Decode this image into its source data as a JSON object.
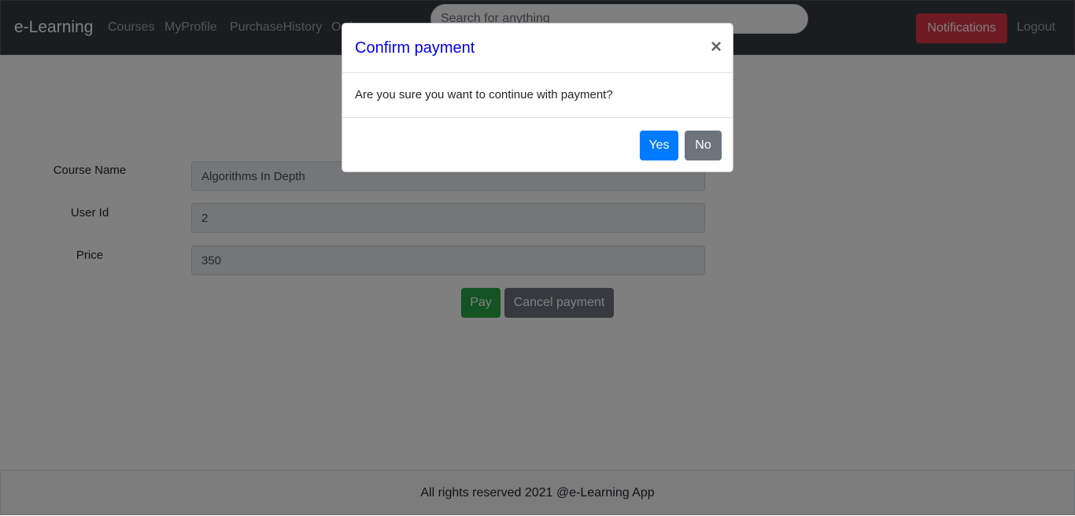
{
  "navbar": {
    "brand": "e-Learning",
    "links": [
      "Courses",
      "MyProfile",
      "PurchaseHistory",
      "Orders"
    ],
    "search_placeholder": "Search for anything",
    "notifications_label": "Notifications",
    "logout_label": "Logout"
  },
  "form": {
    "fields": [
      {
        "label": "Course Name",
        "value": "Algorithms In Depth"
      },
      {
        "label": "User Id",
        "value": "2"
      },
      {
        "label": "Price",
        "value": "350"
      }
    ],
    "pay_label": "Pay",
    "cancel_label": "Cancel payment"
  },
  "footer": {
    "text": "All rights reserved 2021 @e-Learning App"
  },
  "modal": {
    "title": "Confirm payment",
    "close_glyph": "×",
    "body": "Are you sure you want to continue with payment?",
    "yes_label": "Yes",
    "no_label": "No"
  },
  "colors": {
    "navbar_bg": "#343a40",
    "notifications": "#dc3545",
    "pay": "#28a745",
    "secondary": "#6c757d",
    "primary": "#007bff",
    "modal_title": "#0000ee"
  }
}
